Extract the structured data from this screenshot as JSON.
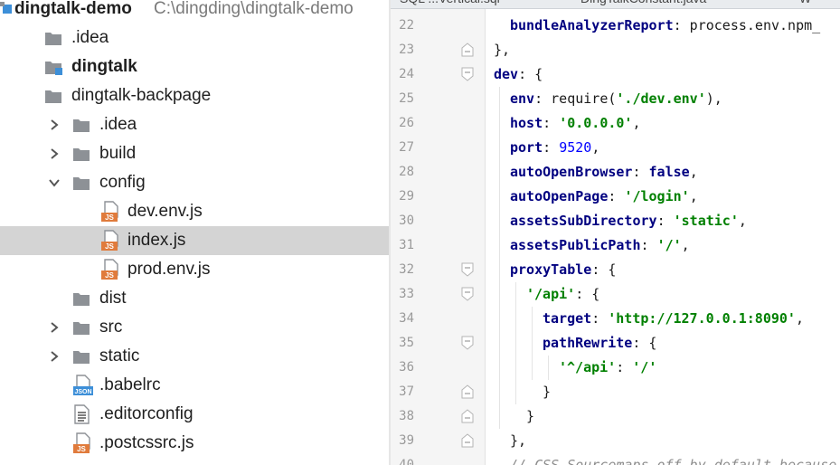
{
  "project_tree": {
    "root": {
      "name": "dingtalk-demo",
      "path": "C:\\dingding\\dingtalk-demo"
    },
    "items": [
      {
        "label": "dingtalk-demo",
        "level": 0,
        "type": "project"
      },
      {
        "label": ".idea",
        "level": 1,
        "type": "folder"
      },
      {
        "label": "dingtalk",
        "level": 1,
        "type": "module"
      },
      {
        "label": "dingtalk-backpage",
        "level": 1,
        "type": "folder-open"
      },
      {
        "label": ".idea",
        "level": 2,
        "type": "folder",
        "expand": "collapsed"
      },
      {
        "label": "build",
        "level": 2,
        "type": "folder",
        "expand": "collapsed"
      },
      {
        "label": "config",
        "level": 2,
        "type": "folder",
        "expand": "expanded"
      },
      {
        "label": "dev.env.js",
        "level": 3,
        "type": "js"
      },
      {
        "label": "index.js",
        "level": 3,
        "type": "js",
        "selected": true
      },
      {
        "label": "prod.env.js",
        "level": 3,
        "type": "js"
      },
      {
        "label": "dist",
        "level": 2,
        "type": "folder"
      },
      {
        "label": "src",
        "level": 2,
        "type": "folder",
        "expand": "collapsed"
      },
      {
        "label": "static",
        "level": 2,
        "type": "folder",
        "expand": "collapsed"
      },
      {
        "label": ".babelrc",
        "level": 2,
        "type": "json"
      },
      {
        "label": ".editorconfig",
        "level": 2,
        "type": "text"
      },
      {
        "label": ".postcssrc.js",
        "level": 2,
        "type": "js"
      }
    ],
    "icon_text": {
      "js": "JS",
      "json": "JSON"
    }
  },
  "editor_tabs": [
    {
      "label": "SQL  ...Vertical.sql"
    },
    {
      "label": "DingTalkConstant.java"
    },
    {
      "label": "W"
    }
  ],
  "editor": {
    "lines": [
      {
        "num": "22",
        "indent": 1,
        "fold": "",
        "tokens": [
          [
            "k",
            "bundleAnalyzerReport"
          ],
          [
            "p",
            ": process.env.npm_"
          ]
        ]
      },
      {
        "num": "23",
        "indent": 0,
        "fold": "end",
        "tokens": [
          [
            "p",
            "},"
          ]
        ]
      },
      {
        "num": "24",
        "indent": 0,
        "fold": "start",
        "tokens": [
          [
            "k",
            "dev"
          ],
          [
            "p",
            ": {"
          ]
        ]
      },
      {
        "num": "25",
        "indent": 1,
        "fold": "",
        "tokens": [
          [
            "k",
            "env"
          ],
          [
            "p",
            ": require("
          ],
          [
            "s",
            "'./dev.env'"
          ],
          [
            "p",
            "),"
          ]
        ]
      },
      {
        "num": "26",
        "indent": 1,
        "fold": "",
        "tokens": [
          [
            "k",
            "host"
          ],
          [
            "p",
            ": "
          ],
          [
            "s",
            "'0.0.0.0'"
          ],
          [
            "p",
            ","
          ]
        ]
      },
      {
        "num": "27",
        "indent": 1,
        "fold": "",
        "tokens": [
          [
            "k",
            "port"
          ],
          [
            "p",
            ": "
          ],
          [
            "n",
            "9520"
          ],
          [
            "p",
            ","
          ]
        ]
      },
      {
        "num": "28",
        "indent": 1,
        "fold": "",
        "tokens": [
          [
            "k",
            "autoOpenBrowser"
          ],
          [
            "p",
            ": "
          ],
          [
            "b",
            "false"
          ],
          [
            "p",
            ","
          ]
        ]
      },
      {
        "num": "29",
        "indent": 1,
        "fold": "",
        "tokens": [
          [
            "k",
            "autoOpenPage"
          ],
          [
            "p",
            ": "
          ],
          [
            "s",
            "'/login'"
          ],
          [
            "p",
            ","
          ]
        ]
      },
      {
        "num": "30",
        "indent": 1,
        "fold": "",
        "tokens": [
          [
            "k",
            "assetsSubDirectory"
          ],
          [
            "p",
            ": "
          ],
          [
            "s",
            "'static'"
          ],
          [
            "p",
            ","
          ]
        ]
      },
      {
        "num": "31",
        "indent": 1,
        "fold": "",
        "tokens": [
          [
            "k",
            "assetsPublicPath"
          ],
          [
            "p",
            ": "
          ],
          [
            "s",
            "'/'"
          ],
          [
            "p",
            ","
          ]
        ]
      },
      {
        "num": "32",
        "indent": 1,
        "fold": "start",
        "tokens": [
          [
            "k",
            "proxyTable"
          ],
          [
            "p",
            ": {"
          ]
        ]
      },
      {
        "num": "33",
        "indent": 2,
        "fold": "start",
        "tokens": [
          [
            "s",
            "'/api'"
          ],
          [
            "p",
            ": {"
          ]
        ]
      },
      {
        "num": "34",
        "indent": 3,
        "fold": "",
        "tokens": [
          [
            "k",
            "target"
          ],
          [
            "p",
            ": "
          ],
          [
            "s",
            "'http://127.0.0.1:8090'"
          ],
          [
            "p",
            ","
          ]
        ]
      },
      {
        "num": "35",
        "indent": 3,
        "fold": "start",
        "tokens": [
          [
            "k",
            "pathRewrite"
          ],
          [
            "p",
            ": {"
          ]
        ]
      },
      {
        "num": "36",
        "indent": 4,
        "fold": "",
        "tokens": [
          [
            "s",
            "'^/api'"
          ],
          [
            "p",
            ": "
          ],
          [
            "s",
            "'/'"
          ]
        ]
      },
      {
        "num": "37",
        "indent": 3,
        "fold": "end",
        "tokens": [
          [
            "p",
            "}"
          ]
        ]
      },
      {
        "num": "38",
        "indent": 2,
        "fold": "end",
        "tokens": [
          [
            "p",
            "}"
          ]
        ]
      },
      {
        "num": "39",
        "indent": 1,
        "fold": "end",
        "tokens": [
          [
            "p",
            "},"
          ]
        ]
      },
      {
        "num": "40",
        "indent": 1,
        "fold": "",
        "tokens": [
          [
            "c",
            "// CSS Sourcemaps off by default because"
          ]
        ]
      }
    ]
  },
  "colors": {
    "selection": "#d4d4d4",
    "folder": "#8d9196",
    "module_badge": "#3d8fd8",
    "js_badge": "#e07b3c",
    "json_badge": "#3d8fd8",
    "keyword": "#000080",
    "string": "#008000",
    "number": "#0000ff"
  }
}
